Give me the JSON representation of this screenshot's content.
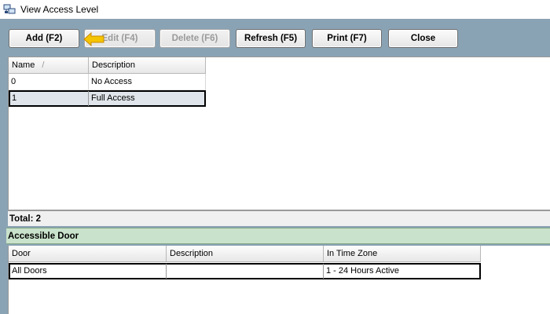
{
  "window": {
    "title": "View Access Level"
  },
  "toolbar": {
    "add_label": "Add (F2)",
    "edit_label": "Edit (F4)",
    "delete_label": "Delete (F6)",
    "refresh_label": "Refresh (F5)",
    "print_label": "Print (F7)",
    "close_label": "Close"
  },
  "access_grid": {
    "columns": [
      "Name",
      "Description"
    ],
    "sort_indicator": "/",
    "rows": [
      {
        "name": "0",
        "description": "No Access"
      },
      {
        "name": "1",
        "description": "Full Access"
      }
    ],
    "selected_row": 1
  },
  "total": {
    "label": "Total:",
    "count": "2"
  },
  "section": {
    "title": "Accessible Door"
  },
  "door_grid": {
    "columns": [
      "Door",
      "Description",
      "In Time Zone"
    ],
    "rows": [
      {
        "door": "All Doors",
        "description": "",
        "time_zone": "1 - 24 Hours Active"
      }
    ]
  },
  "icons": {
    "app": "network-icon",
    "pointer": "arrow-pointer-icon"
  },
  "colors": {
    "body_bg": "#8aa3b4",
    "section_header_bg": "#c9e2cb",
    "selected_row_bg": "#dfe5ea",
    "pointer": "#f5c400"
  }
}
